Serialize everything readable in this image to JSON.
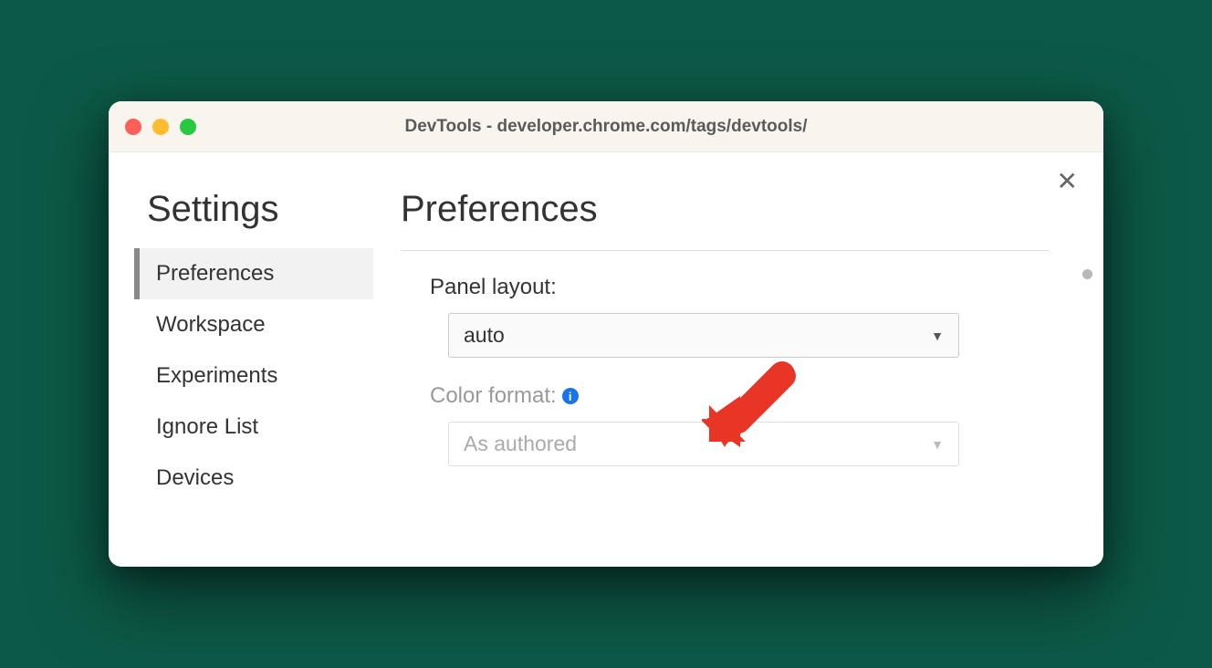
{
  "window": {
    "title": "DevTools - developer.chrome.com/tags/devtools/"
  },
  "sidebar": {
    "title": "Settings",
    "items": [
      {
        "label": "Preferences",
        "active": true
      },
      {
        "label": "Workspace",
        "active": false
      },
      {
        "label": "Experiments",
        "active": false
      },
      {
        "label": "Ignore List",
        "active": false
      },
      {
        "label": "Devices",
        "active": false
      }
    ]
  },
  "panel": {
    "title": "Preferences",
    "settings": {
      "panel_layout": {
        "label": "Panel layout:",
        "value": "auto"
      },
      "color_format": {
        "label": "Color format:",
        "value": "As authored",
        "disabled": true
      }
    }
  }
}
